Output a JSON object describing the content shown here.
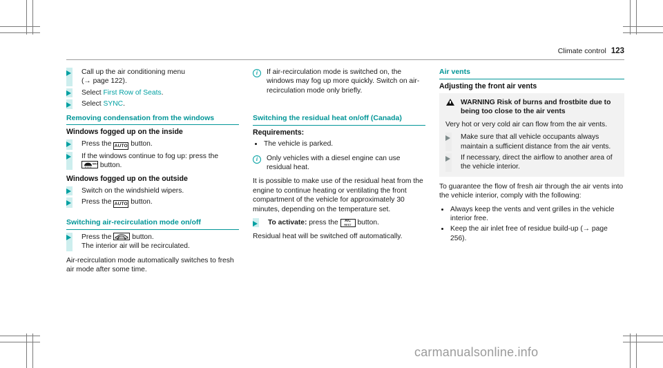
{
  "header": {
    "chapter": "Climate control",
    "page_number": "123"
  },
  "watermark": "carmanualsonline.info",
  "column1": {
    "steps_top": [
      "Call up the air conditioning menu (→ page 122).",
      "Select First Row of Seats.",
      "Select SYNC."
    ],
    "step1_text": "Call up the air conditioning menu",
    "step1_ref": "(→ page 122).",
    "step2_prefix": "Select ",
    "step2_link": "First Row of Seats",
    "step2_suffix": ".",
    "step3_prefix": "Select ",
    "step3_link": "SYNC",
    "step3_suffix": ".",
    "section1_title": "Removing condensation from the windows",
    "sub1_title": "Windows fogged up on the inside",
    "s1_step1_pre": "Press the",
    "s1_step1_key": "AUTO",
    "s1_step1_post": "button.",
    "s1_step2_line1": "If the windows continue to fog up: press the",
    "s1_step2_key": "max-defrost-icon",
    "s1_step2_post": "button.",
    "sub2_title": "Windows fogged up on the outside",
    "s2_step1": "Switch on the windshield wipers.",
    "s2_step2_pre": "Press the",
    "s2_step2_key": "AUTO",
    "s2_step2_post": "button.",
    "section2_title": "Switching air-recirculation mode on/off",
    "s3_step1_pre": "Press the",
    "s3_step1_key": "air-recirculation-icon",
    "s3_step1_post": "button.",
    "s3_step1_note": "The interior air will be recirculated.",
    "closing": "Air-recirculation mode automatically switches to fresh air mode after some time."
  },
  "column2": {
    "note1": "If air-recirculation mode is switched on, the windows may fog up more quickly. Switch on air-recirculation mode only briefly.",
    "section_title": "Switching the residual heat on/off (Canada)",
    "requirements_label": "Requirements:",
    "requirements": [
      "The vehicle is parked."
    ],
    "note2": "Only vehicles with a diesel engine can use residual heat.",
    "paragraph": "It is possible to make use of the residual heat from the engine to continue heating or ventilating the front compartment of the vehicle for approximately 30 minutes, depending on the temperature set.",
    "activate_bold": "To activate:",
    "activate_pre": " press the",
    "activate_key": "A/C REST",
    "activate_post": "button.",
    "closing": "Residual heat will be switched off automatically."
  },
  "column3": {
    "section_title": "Air vents",
    "sub_title": "Adjusting the front air vents",
    "warning_label": "WARNING",
    "warning_text": "Risk of burns and frostbite due to being too close to the air vents",
    "warning_body": "Very hot or very cold air can flow from the air vents.",
    "warning_steps": [
      "Make sure that all vehicle occupants always maintain a sufficient distance from the air vents.",
      "If necessary, direct the airflow to another area of the vehicle interior."
    ],
    "intro": "To guarantee the flow of fresh air through the air vents into the vehicle interior, comply with the following:",
    "bullets": [
      "Always keep the vents and vent grilles in the vehicle interior free.",
      "Keep the air inlet free of residue build-up (→ page 256)."
    ]
  },
  "colors": {
    "accent_teal": "#00a0a2",
    "rule_teal": "#009597",
    "bullet_bar": "#cdeeee",
    "warning_bg": "#f2f2f2",
    "watermark_gray": "#9b9b9b"
  }
}
